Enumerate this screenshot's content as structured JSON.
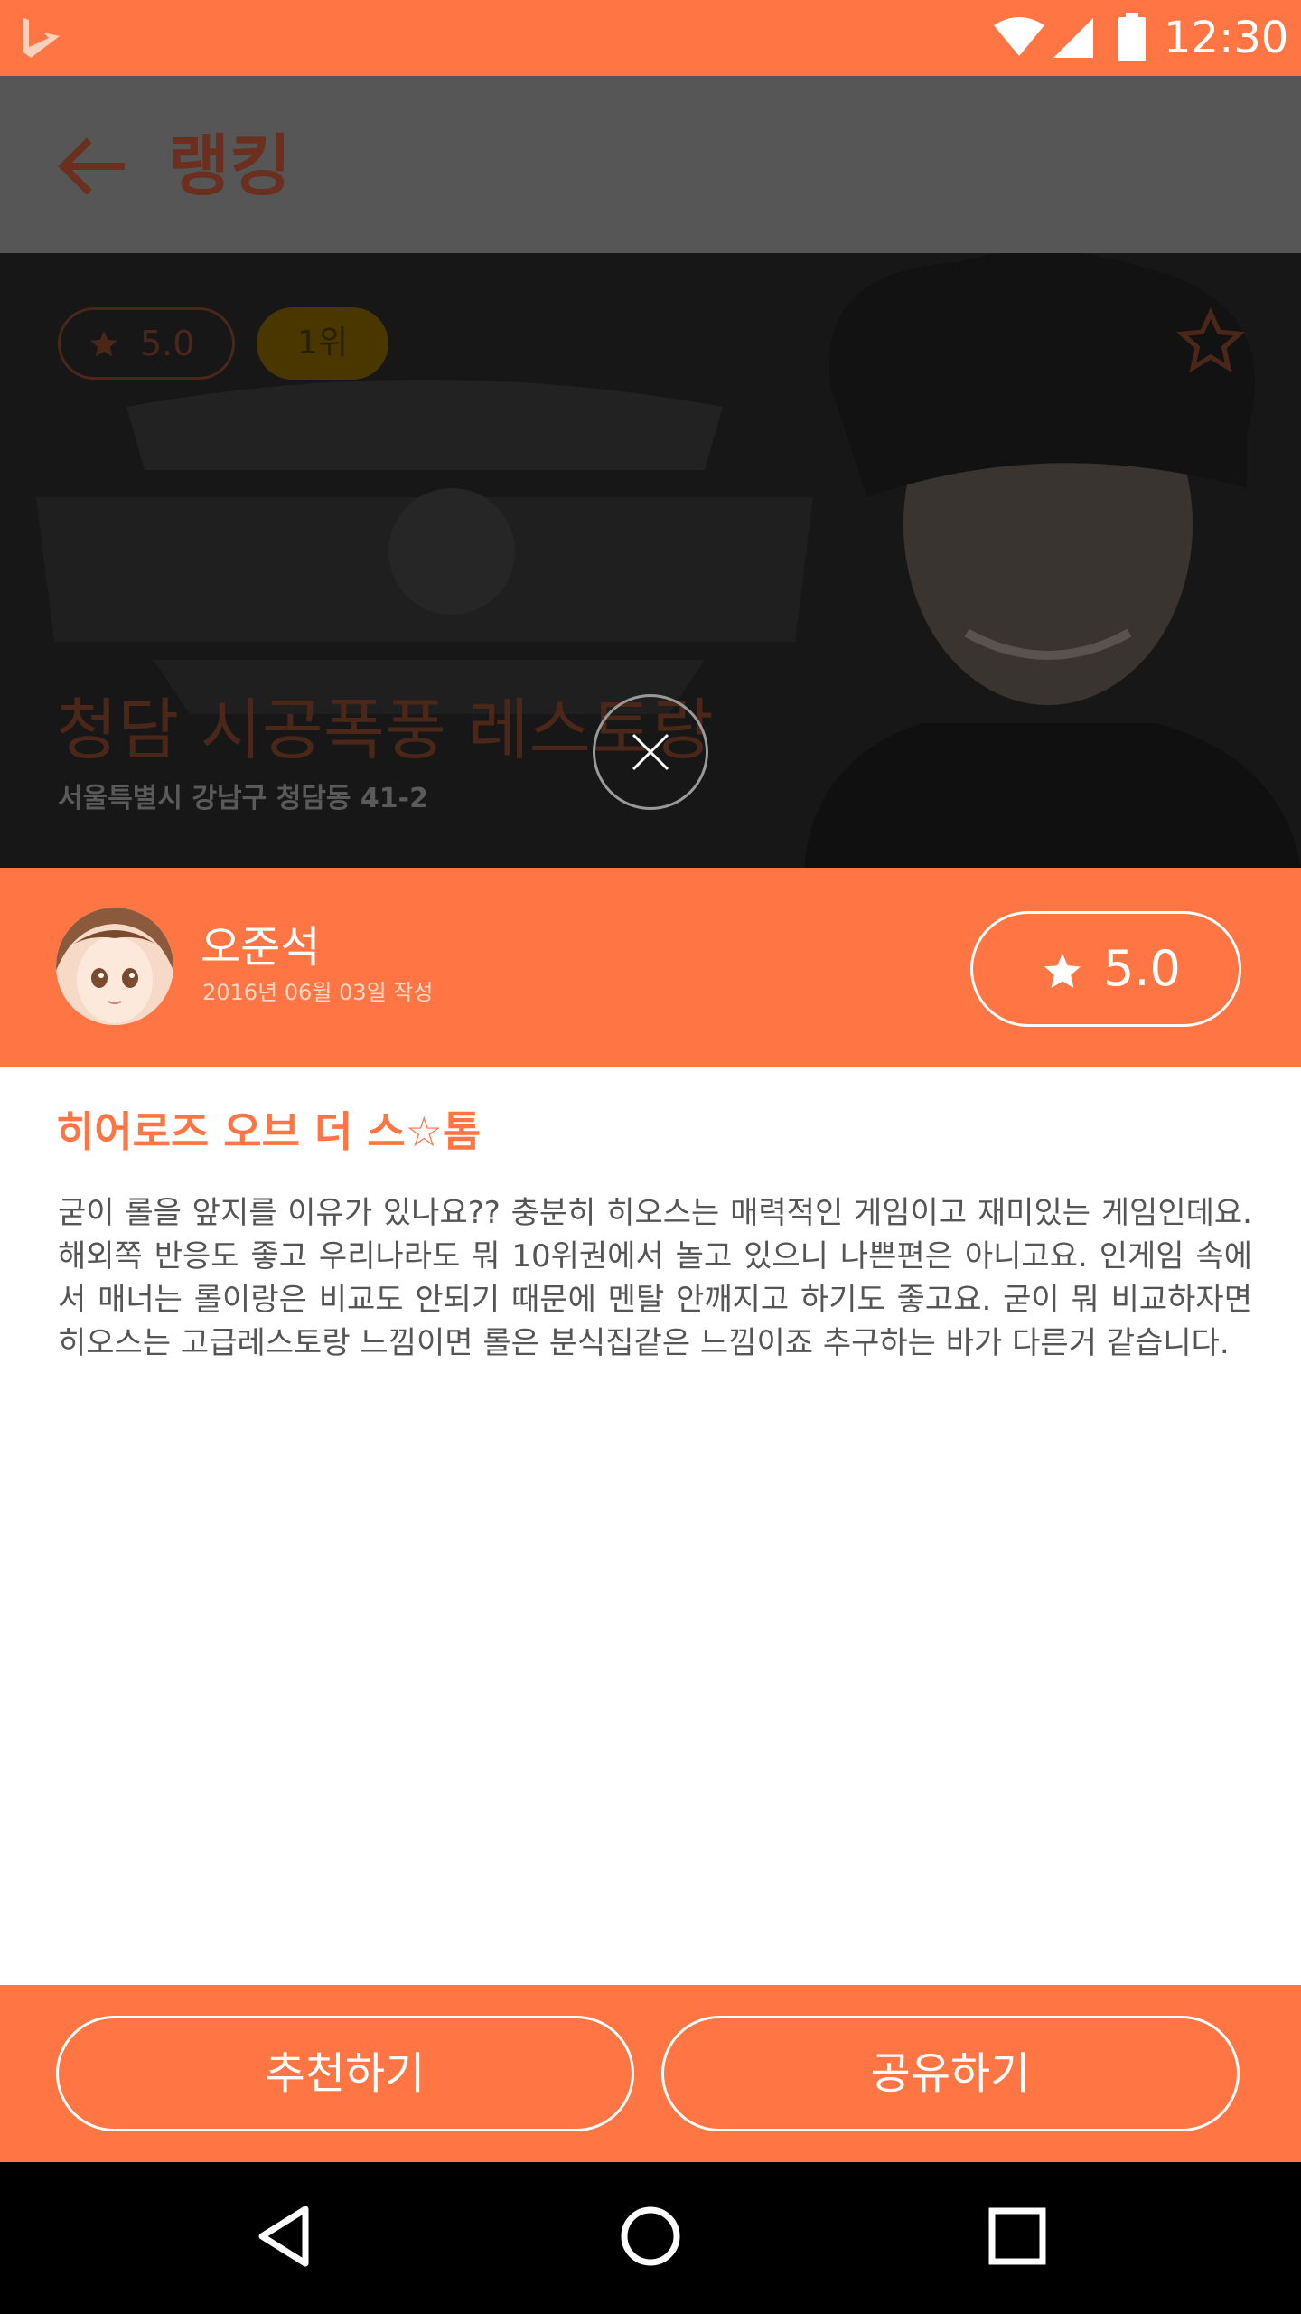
{
  "status_bar": {
    "time": "12:30"
  },
  "app_bar": {
    "title": "랭킹"
  },
  "restaurant": {
    "rating": "5.0",
    "rank": "1위",
    "name": "청담 시공폭풍 레스토랑",
    "address": "서울특별시 강남구 청담동 41-2"
  },
  "review": {
    "author": "오준석",
    "date": "2016년 06월 03일 작성",
    "score": "5.0",
    "title": "히어로즈 오브 더 스☆톰",
    "body": "굳이 롤을 앞지를 이유가 있나요?? 충분히 히오스는 매력적인 게임이고 재미있는 게임인데요. 해외쪽 반응도 좋고 우리나라도 뭐 10위권에서 놀고 있으니 나쁜편은 아니고요. 인게임 속에서 매너는 롤이랑은 비교도 안되기 때문에 멘탈 안깨지고 하기도 좋고요. 굳이 뭐 비교하자면 히오스는 고급레스토랑 느낌이면 롤은 분식집같은 느낌이죠 추구하는 바가 다른거 같습니다."
  },
  "actions": {
    "recommend_label": "추천하기",
    "share_label": "공유하기"
  },
  "colors": {
    "accent": "#ff7543",
    "overlay_dark": "#565656",
    "text_body": "#555555"
  },
  "icons": [
    "app-logo-icon",
    "wifi-icon",
    "cell-signal-icon",
    "battery-icon",
    "back-arrow-icon",
    "star-icon",
    "star-outline-icon",
    "close-icon",
    "nav-back-icon",
    "nav-home-icon",
    "nav-recents-icon"
  ]
}
